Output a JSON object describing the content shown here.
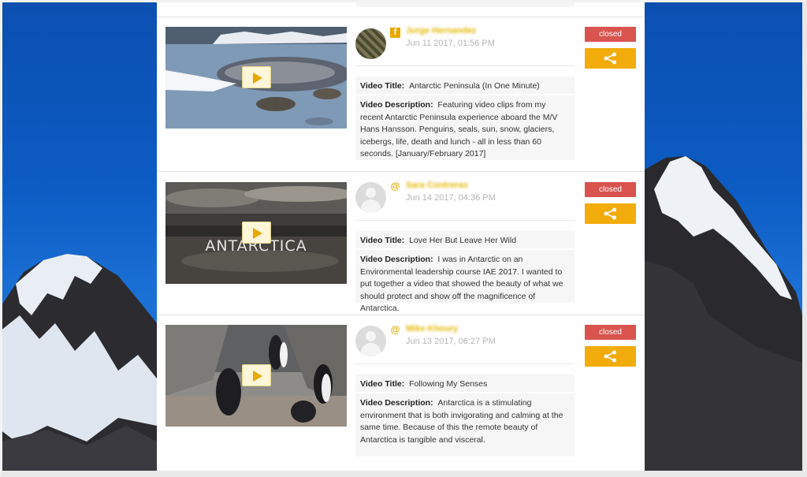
{
  "colors": {
    "sky": "#0c5cc4",
    "accent": "#f2ac0c",
    "closed": "#d9534f"
  },
  "cards": [
    {
      "thumbnail": "penguins-and-seal-on-ice",
      "source_icon": "facebook-icon",
      "source_glyph": "f",
      "username": "Jorge Hernandez",
      "date": "Jun 11 2017, 01:56 PM",
      "title_label": "Video Title:",
      "title": "Antarctic Peninsula (In One Minute)",
      "description_label": "Video Description:",
      "description": "Featuring video clips from my recent Antarctic Peninsula experience aboard the M/V Hans Hansson. Penguins, seals, sun, snow, glaciers, icebergs, life, death and lunch - all in less than 60 seconds. [January/February 2017]",
      "status": "closed",
      "share_icon": "share-icon"
    },
    {
      "thumbnail": "antarctica-cloudy-shore",
      "thumbnail_caption": "ANTARCTICA",
      "source_icon": "at-icon",
      "source_glyph": "@",
      "username": "Sara Contreras",
      "date": "Jun 14 2017, 04:36 PM",
      "title_label": "Video Title:",
      "title": "Love Her But Leave Her Wild",
      "description_label": "Video Description:",
      "description": "I was in Antarctic on an Environmental leadership course IAE 2017. I wanted to put together a video that showed the beauty of what we should protect and show off the magnificence of Antarctica.",
      "status": "closed",
      "share_icon": "share-icon"
    },
    {
      "thumbnail": "penguin-colony-rocks",
      "source_icon": "at-icon",
      "source_glyph": "@",
      "username": "Mike Khoury",
      "date": "Jun 13 2017, 06:27 PM",
      "title_label": "Video Title:",
      "title": "Following My Senses",
      "description_label": "Video Description:",
      "description": "Antarctica is a stimulating environment that is both invigorating and calming at the same time. Because of this the remote beauty of Antarctica is tangible and visceral.",
      "status": "closed",
      "share_icon": "share-icon"
    }
  ]
}
